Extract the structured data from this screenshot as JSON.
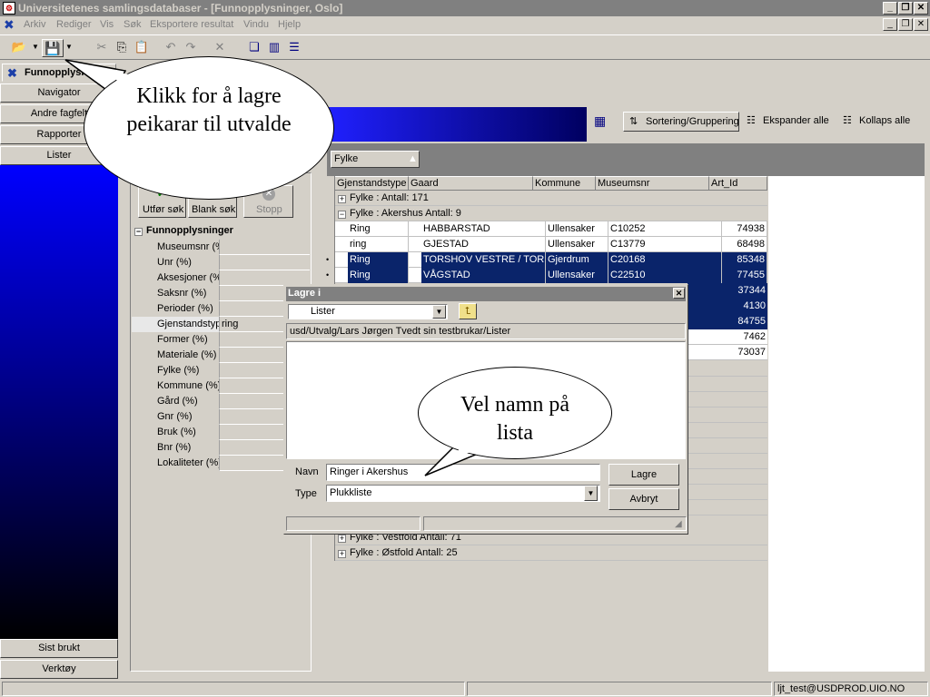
{
  "window": {
    "title": "Universitetenes samlingsdatabaser - [Funnopplysninger, Oslo]"
  },
  "menu": [
    "Arkiv",
    "Rediger",
    "Vis",
    "Søk",
    "Eksportere resultat",
    "Vindu",
    "Hjelp"
  ],
  "tab": {
    "label": "Funnopplysninger"
  },
  "nav": {
    "items": [
      "Navigator",
      "Andre fagfelt",
      "Rapporter",
      "Lister"
    ],
    "bottom": [
      "Sist brukt",
      "Verktøy"
    ]
  },
  "search": {
    "run": "Utfør søk",
    "blank": "Blank søk",
    "stop": "Stopp",
    "group_title": "Funnopplysninger",
    "fields": [
      {
        "label": "Museumsnr (%",
        "value": ""
      },
      {
        "label": "Unr (%)",
        "value": ""
      },
      {
        "label": "Aksesjoner (%",
        "value": ""
      },
      {
        "label": "Saksnr (%)",
        "value": ""
      },
      {
        "label": "Perioder (%)",
        "value": ""
      },
      {
        "label": "Gjenstandstype",
        "value": "ring"
      },
      {
        "label": "Former (%)",
        "value": ""
      },
      {
        "label": "Materiale (%)",
        "value": ""
      },
      {
        "label": "Fylke (%)",
        "value": ""
      },
      {
        "label": "Kommune (%)",
        "value": ""
      },
      {
        "label": "Gård (%)",
        "value": ""
      },
      {
        "label": "Gnr (%)",
        "value": ""
      },
      {
        "label": "Bruk (%)",
        "value": ""
      },
      {
        "label": "Bnr (%)",
        "value": ""
      },
      {
        "label": "Lokaliteter (%)",
        "value": ""
      }
    ]
  },
  "grid": {
    "sort_label": "Sortering/Gruppering",
    "expand_label": "Ekspander alle",
    "collapse_label": "Kollaps alle",
    "group_by": "Fylke",
    "columns": [
      "Gjenstandstype",
      "Gaard",
      "Kommune",
      "Museumsnr",
      "Art_Id"
    ],
    "groups_top": [
      {
        "label": "Fylke :  Antall: 171",
        "expanded": "+"
      },
      {
        "label": "Fylke : Akershus  Antall: 9",
        "expanded": "−"
      }
    ],
    "rows": [
      {
        "type": "Ring",
        "gaard": "HABBARSTAD",
        "kommune": "Ullensaker",
        "museumsnr": "C10252",
        "art_id": "74938",
        "selected": false
      },
      {
        "type": "ring",
        "gaard": "GJESTAD",
        "kommune": "Ullensaker",
        "museumsnr": "C13779",
        "art_id": "68498",
        "selected": false
      },
      {
        "type": "Ring",
        "gaard": "TORSHOV VESTRE / TOR",
        "kommune": "Gjerdrum",
        "museumsnr": "C20168",
        "art_id": "85348",
        "selected": true
      },
      {
        "type": "Ring",
        "gaard": "VÅGSTAD",
        "kommune": "Ullensaker",
        "museumsnr": "C22510",
        "art_id": "77455",
        "selected": true
      }
    ],
    "hidden_ids": [
      "37344",
      "4130",
      "84755",
      "7462",
      "73037"
    ],
    "groups_bottom": [
      {
        "label": "Fylke : Vestfold  Antall: 71"
      },
      {
        "label": "Fylke : Østfold  Antall: 25"
      }
    ]
  },
  "dialog": {
    "title": "Lagre i",
    "location": "Lister",
    "path": "usd/Utvalg/Lars Jørgen Tvedt sin testbrukar/Lister",
    "name_label": "Navn",
    "name_value": "Ringer i Akershus",
    "type_label": "Type",
    "type_value": "Plukkliste",
    "save": "Lagre",
    "cancel": "Avbryt"
  },
  "callouts": {
    "save_tip": "Klikk for å lagre peikarar til utvalde",
    "name_tip": "Vel namn på lista"
  },
  "status": {
    "user": "ljt_test@USDPROD.UIO.NO"
  }
}
